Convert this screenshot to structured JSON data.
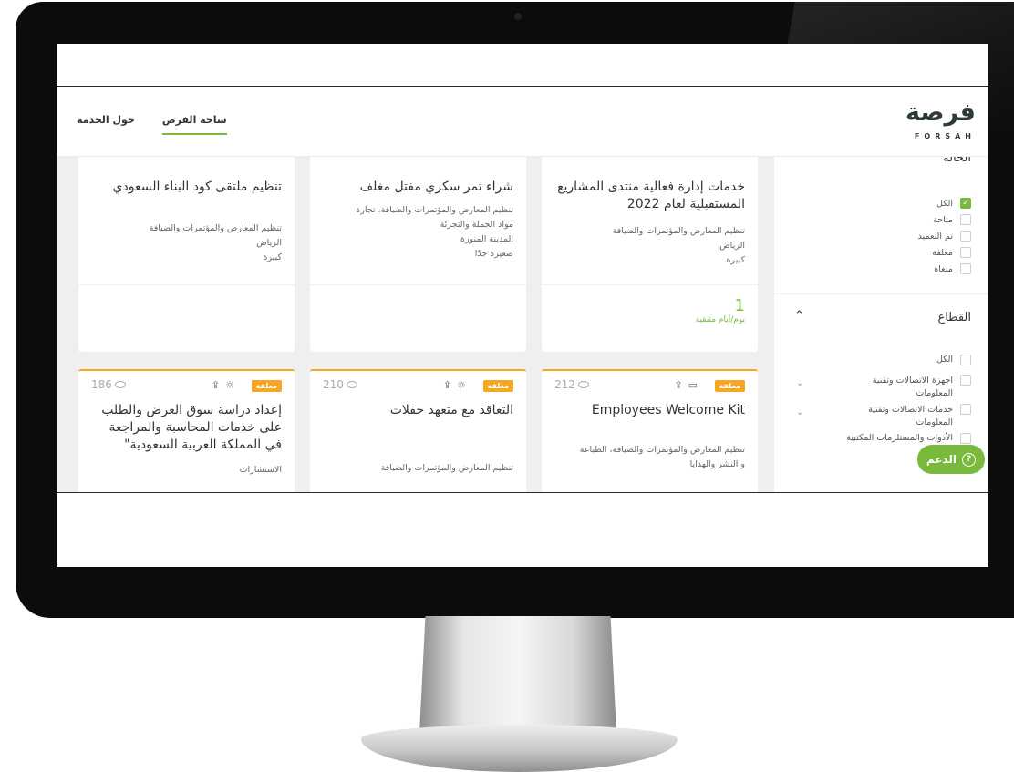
{
  "header": {
    "logo_ar": "فرصة",
    "logo_en": "FORSAH",
    "nav": [
      {
        "label": "ساحة الفرص",
        "active": true
      },
      {
        "label": "حول الخدمة",
        "active": false
      }
    ]
  },
  "cards_top": [
    {
      "views": "",
      "badge": "",
      "title": "خدمات إدارة فعالية منتدى المشاريع المستقبلية لعام 2022",
      "meta": [
        "تنظيم المعارض والمؤتمرات والضيافة",
        "الرياض",
        "كبيرة"
      ],
      "days_num": "1",
      "days_label": "يوم/أيام متبقية"
    },
    {
      "views": "",
      "badge": "",
      "title": "شراء تمر سكري مفتل مغلف",
      "meta": [
        "تنظيم المعارض والمؤتمرات والضيافة، تجارة",
        "مواد الجملة والتجزئة",
        "المدينة المنورة",
        "صغيرة جدّا"
      ],
      "days_num": "",
      "days_label": ""
    },
    {
      "views": "",
      "badge": "",
      "title": "تنظيم ملتقى كود البناء السعودي",
      "meta": [
        "تنظيم المعارض والمؤتمرات والضيافة",
        "الرياض",
        "كبيرة"
      ],
      "days_num": "",
      "days_label": ""
    }
  ],
  "cards_bottom": [
    {
      "views": "212",
      "badge": "معلقة",
      "title": "Employees Welcome Kit",
      "meta": [
        "تنظيم المعارض والمؤتمرات والضيافة، الطباعة",
        "و النشر والهدايا"
      ]
    },
    {
      "views": "210",
      "badge": "معلقة",
      "title": "التعاقد مع متعهد حفلات",
      "meta": [
        "تنظيم المعارض والمؤتمرات والضيافة"
      ]
    },
    {
      "views": "186",
      "badge": "معلقة",
      "title": "إعداد دراسة سوق العرض والطلب على خدمات المحاسبة والمراجعة في المملكة العربية السعودية\"",
      "meta": [
        "الاستشارات"
      ]
    }
  ],
  "sidebar": {
    "status_title": "الحالة",
    "status_options": [
      {
        "label": "الكل",
        "checked": true
      },
      {
        "label": "متاحة",
        "checked": false
      },
      {
        "label": "تم التعميد",
        "checked": false
      },
      {
        "label": "معلقة",
        "checked": false
      },
      {
        "label": "ملغاة",
        "checked": false
      }
    ],
    "sector_title": "القطاع",
    "sector_options": [
      {
        "label": "الكل",
        "sub": false
      },
      {
        "label": "اجهزة الاتصالات وتقنية المعلومات",
        "sub": true
      },
      {
        "label": "خدمات الاتصالات وتقنية المعلومات",
        "sub": true
      },
      {
        "label": "الأدوات والمستلزمات المكتبية",
        "sub": false
      }
    ]
  },
  "support_label": "الدعم",
  "colors": {
    "accent": "#79b93c",
    "pending": "#f5a623"
  }
}
